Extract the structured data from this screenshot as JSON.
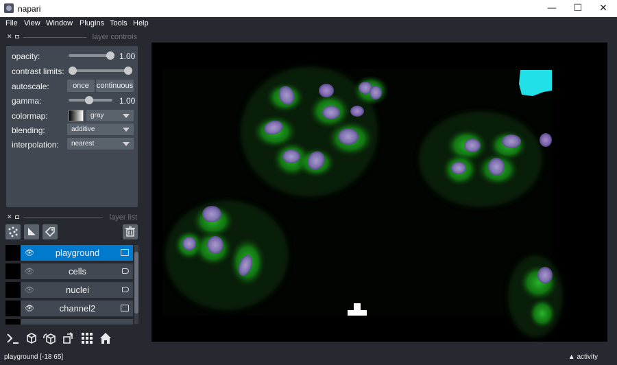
{
  "window": {
    "title": "napari",
    "minimize": "—",
    "maximize": "☐",
    "close": "✕"
  },
  "menu": [
    "File",
    "View",
    "Window",
    "Plugins",
    "Tools",
    "Help"
  ],
  "layer_controls": {
    "header": "layer controls",
    "opacity": {
      "label": "opacity:",
      "value": "1.00",
      "level": 1.0
    },
    "contrast_limits": {
      "label": "contrast limits:",
      "low": 0.0,
      "high": 1.0
    },
    "autoscale": {
      "label": "autoscale:",
      "once": "once",
      "continuous": "continuous"
    },
    "gamma": {
      "label": "gamma:",
      "value": "1.00",
      "level": 0.33
    },
    "colormap": {
      "label": "colormap:",
      "value": "gray"
    },
    "blending": {
      "label": "blending:",
      "value": "additive"
    },
    "interpolation": {
      "label": "interpolation:",
      "value": "nearest"
    }
  },
  "layer_list": {
    "header": "layer list",
    "layers": [
      {
        "name": "playground",
        "type": "image",
        "visible": true,
        "selected": true
      },
      {
        "name": "cells",
        "type": "labels",
        "visible": false,
        "selected": false
      },
      {
        "name": "nuclei",
        "type": "labels",
        "visible": false,
        "selected": false
      },
      {
        "name": "channel2",
        "type": "image",
        "visible": true,
        "selected": false
      }
    ]
  },
  "status": {
    "text": "playground [-18 65]",
    "activity": "activity"
  },
  "icons": {
    "points": "points-icon",
    "shapes": "shapes-icon",
    "labels": "labels-icon",
    "delete": "trash-icon",
    "console": "console-icon",
    "ndisplay": "3d-cube-icon",
    "roll": "roll-dims-icon",
    "transpose": "transpose-icon",
    "grid": "grid-icon",
    "home": "home-icon"
  }
}
